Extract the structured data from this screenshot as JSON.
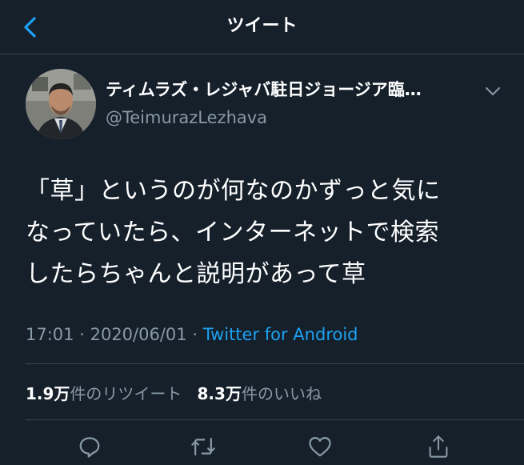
{
  "header": {
    "title": "ツイート",
    "back_icon": "chevron-left-icon"
  },
  "author": {
    "name": "ティムラズ・レジャバ駐日ジョージア臨…",
    "handle": "@TeimurazLezhava"
  },
  "tweet": {
    "lines": [
      "「草」というのが何なのかずっと気に",
      "なっていたら、インターネットで検索",
      "したらちゃんと説明があって草"
    ],
    "time": "17:01",
    "date": "2020/06/01",
    "separator": "·",
    "source": "Twitter for Android"
  },
  "stats": {
    "retweets_count": "1.9万",
    "retweets_label": "件のリツイート",
    "likes_count": "8.3万",
    "likes_label": "件のいいね"
  },
  "actions": [
    "reply-icon",
    "retweet-icon",
    "like-icon",
    "share-icon"
  ],
  "colors": {
    "background": "#15202b",
    "accent": "#1da1f2",
    "secondary_text": "#8899a6",
    "divider": "#38444d"
  }
}
